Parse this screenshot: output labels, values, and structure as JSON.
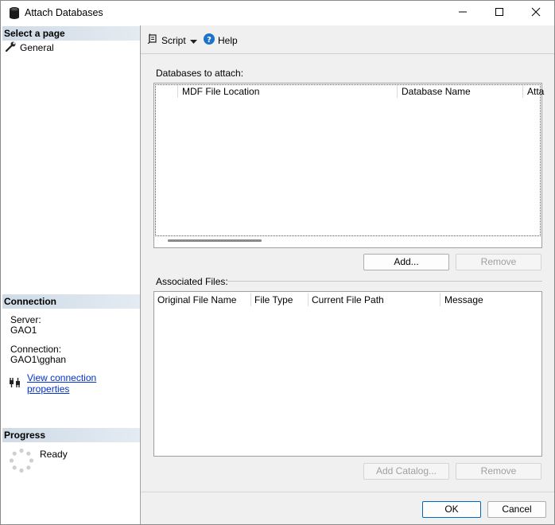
{
  "window": {
    "title": "Attach Databases",
    "icons": {
      "app": "database-icon",
      "minimize": "minimize-icon",
      "maximize": "maximize-icon",
      "close": "close-icon"
    }
  },
  "sidebar": {
    "select_page_header": "Select a page",
    "pages": [
      {
        "label": "General",
        "icon": "wrench-icon"
      }
    ],
    "connection": {
      "header": "Connection",
      "server_label": "Server:",
      "server_value": "GAO1",
      "connection_label": "Connection:",
      "connection_value": "GAO1\\gghan",
      "view_properties_link": "View connection properties",
      "link_icon": "connection-plug-icon"
    },
    "progress": {
      "header": "Progress",
      "status": "Ready",
      "icon": "progress-spinner-icon"
    }
  },
  "toolbar": {
    "script_label": "Script",
    "script_icon": "script-icon",
    "help_label": "Help",
    "help_icon": "help-icon"
  },
  "databases_section": {
    "label": "Databases to attach:",
    "columns": [
      "MDF File Location",
      "Database Name",
      "Atta"
    ],
    "rows": [],
    "add_button": "Add...",
    "remove_button": "Remove"
  },
  "associated_section": {
    "label": "Associated Files:",
    "columns": [
      "Original File Name",
      "File Type",
      "Current File Path",
      "Message"
    ],
    "rows": [],
    "add_catalog_button": "Add Catalog...",
    "remove_button": "Remove"
  },
  "footer": {
    "ok_button": "OK",
    "cancel_button": "Cancel"
  },
  "colors": {
    "section_header_start": "#cfdbe7",
    "link": "#0033cc",
    "help_icon": "#1e73c8",
    "primary_border": "#0067c0"
  }
}
